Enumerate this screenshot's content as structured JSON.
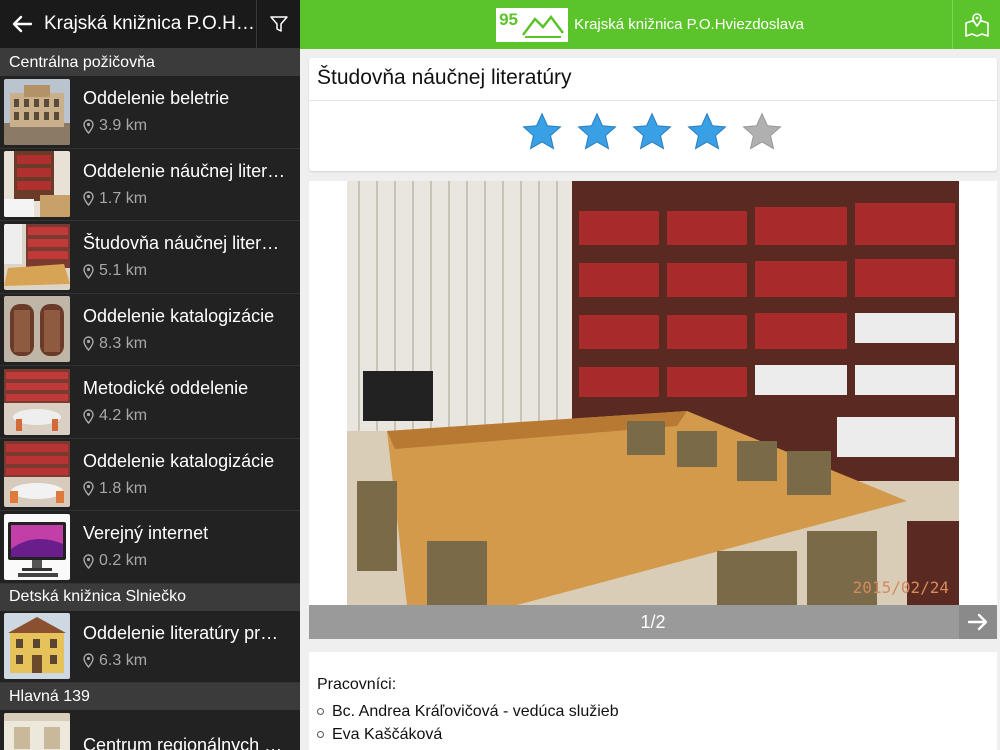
{
  "left_panel": {
    "title": "Krajská knižnica P.O.Hviezdoslava",
    "sections": [
      {
        "header": "Centrálna požičovňa"
      },
      {
        "header": "Detská knižnica Slniečko"
      },
      {
        "header": "Hlavná 139"
      }
    ],
    "items": [
      {
        "name": "Oddelenie beletrie",
        "distance": "3.9 km"
      },
      {
        "name": "Oddelenie náučnej literatúry",
        "distance": "1.7 km"
      },
      {
        "name": "Študovňa náučnej literatúry",
        "distance": "5.1 km"
      },
      {
        "name": "Oddelenie katalogizácie",
        "distance": "8.3 km"
      },
      {
        "name": "Metodické oddelenie",
        "distance": "4.2 km"
      },
      {
        "name": "Oddelenie katalogizácie",
        "distance": "1.8 km"
      },
      {
        "name": "Verejný internet",
        "distance": "0.2 km"
      },
      {
        "name": "Oddelenie literatúry pre deti",
        "distance": "6.3 km"
      },
      {
        "name": "Centrum regionálnych dokumentov",
        "distance": ""
      }
    ]
  },
  "topbar": {
    "logo_number": "95",
    "title": "Krajská knižnica P.O.Hviezdoslava"
  },
  "detail": {
    "title": "Študovňa náučnej literatúry",
    "rating": 4,
    "rating_max": 5,
    "photo_date": "2015/02/24",
    "photo_counter": "1/2",
    "staff_label": "Pracovníci:",
    "staff": [
      "Bc. Andrea Kráľovičová - vedúca služieb",
      "Eva Kaščáková"
    ]
  },
  "colors": {
    "accent_green": "#5cc42b",
    "star_filled": "#3aa0e6",
    "star_empty": "#b0b0b0"
  }
}
